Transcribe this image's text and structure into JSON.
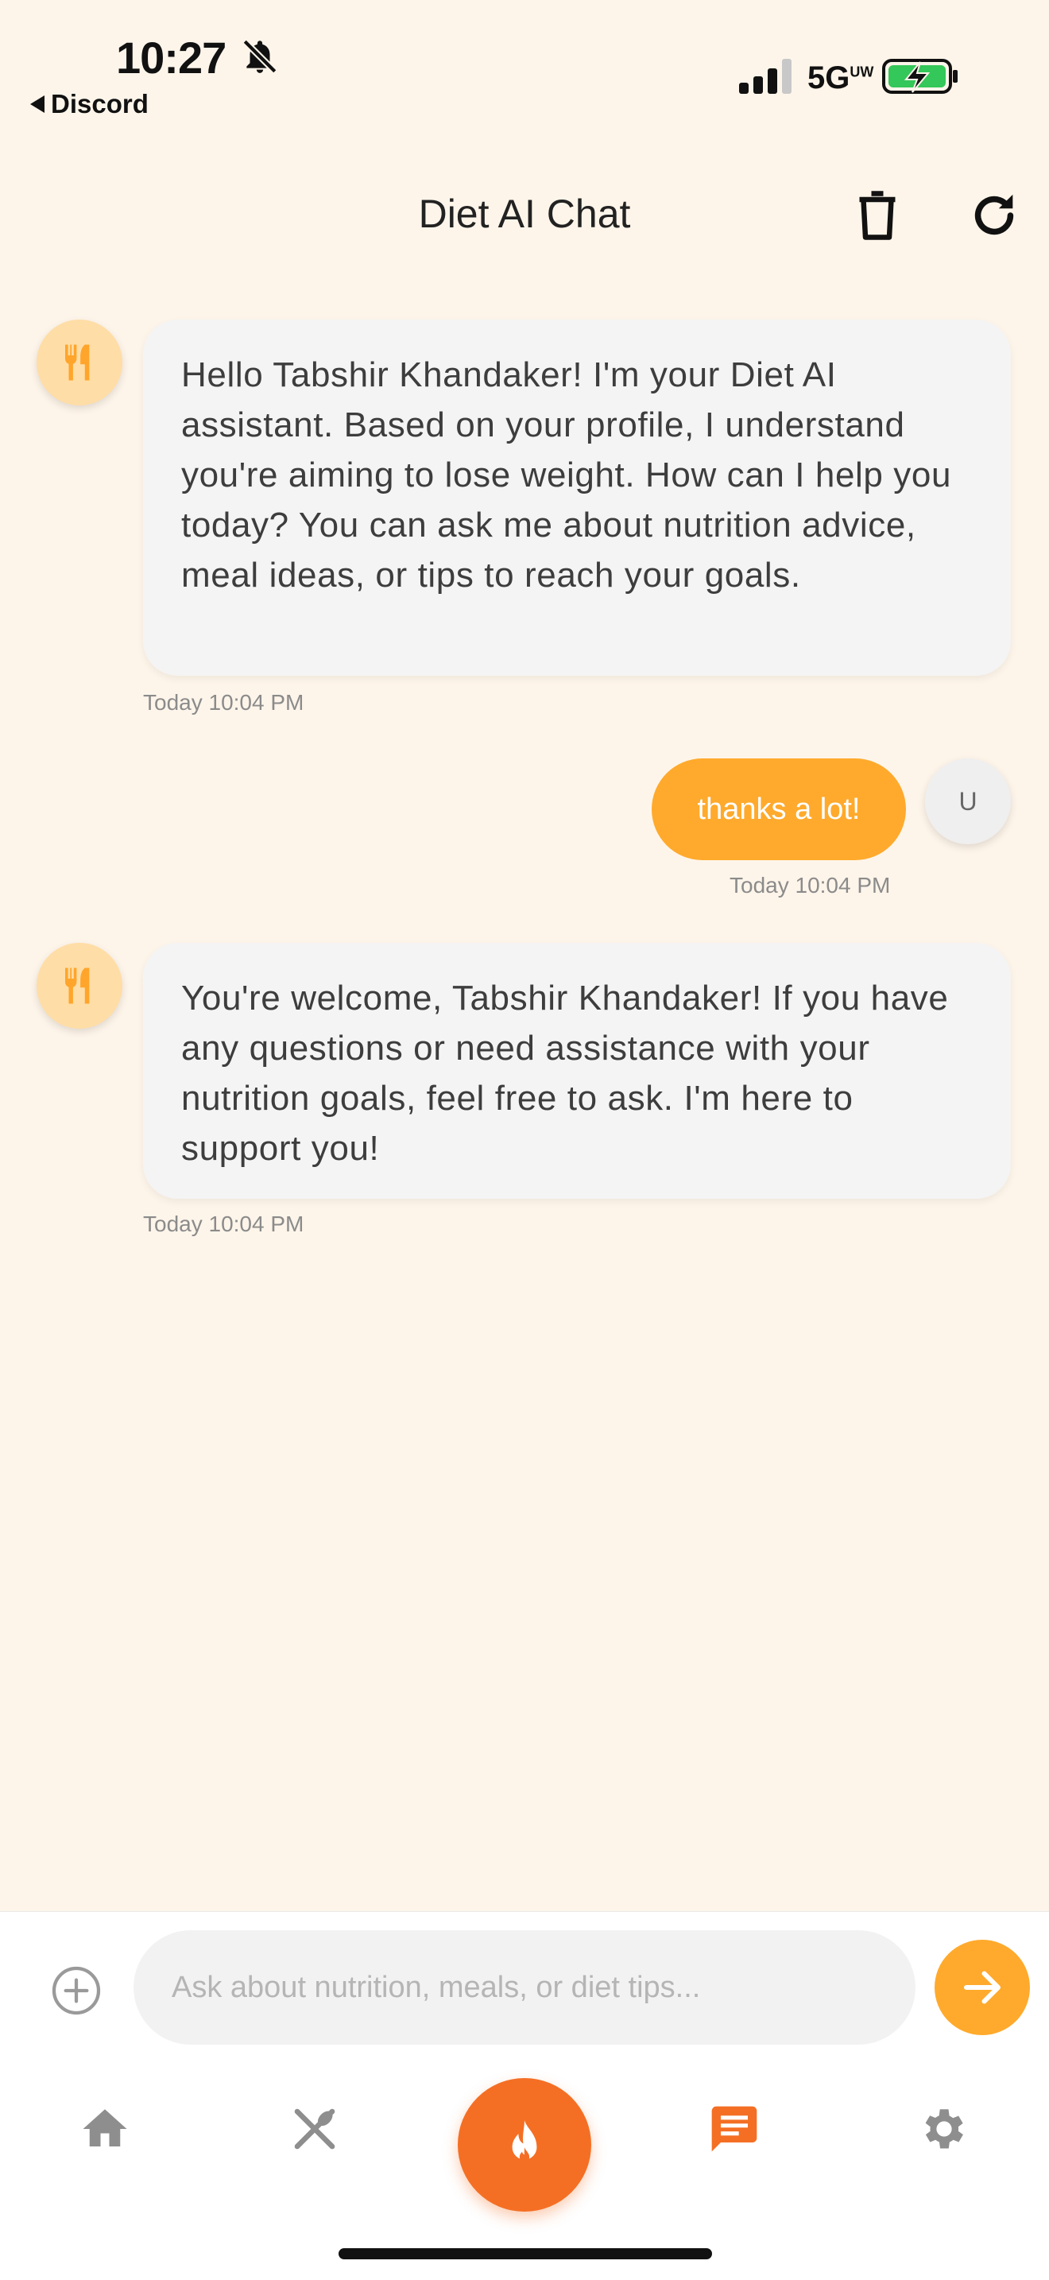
{
  "status_bar": {
    "time": "10:27",
    "back_app": "Discord",
    "network": "5G",
    "network_suffix": "UW"
  },
  "header": {
    "title": "Diet AI Chat"
  },
  "messages": [
    {
      "sender": "bot",
      "text": "Hello Tabshir Khandaker! I'm your Diet AI assistant. Based on your profile, I understand you're aiming to lose weight. How can I help you today? You can ask me about nutrition advice, meal ideas, or tips to reach your goals.",
      "time": "Today 10:04 PM"
    },
    {
      "sender": "user",
      "text": "thanks a lot!",
      "time": "Today 10:04 PM"
    },
    {
      "sender": "bot",
      "text": "You're welcome, Tabshir Khandaker! If you have any questions or need assistance with your nutrition goals, feel free to ask. I'm here to support you!",
      "time": "Today 10:04 PM"
    }
  ],
  "user_avatar_initial": "U",
  "input": {
    "placeholder": "Ask about nutrition, meals, or diet tips...",
    "value": ""
  },
  "nav": {
    "items": [
      "home-icon",
      "utensils-icon",
      "flame-icon",
      "chat-icon",
      "gear-icon"
    ],
    "active": "chat-icon"
  },
  "colors": {
    "background": "#FEF5EA",
    "accent": "#FFAA2C",
    "accent_dark": "#F46F24",
    "bot_avatar_bg": "#FFDDA6",
    "nav_inactive": "#8E8E8E"
  }
}
